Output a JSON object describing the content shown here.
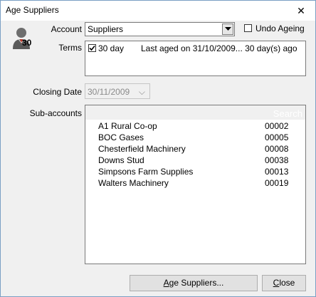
{
  "window": {
    "title": "Age Suppliers",
    "close_glyph": "✕"
  },
  "avatar": {
    "icon": "user-avatar-icon",
    "number": "30"
  },
  "account": {
    "label": "Account",
    "value": "Suppliers"
  },
  "undo_ageing": {
    "label": "Undo Ageing",
    "checked": false
  },
  "terms": {
    "label": "Terms",
    "checked": true,
    "period": "30 day",
    "last_aged": "Last aged on 31/10/2009... 30 day(s) ago"
  },
  "closing_date": {
    "label": "Closing Date",
    "value": "30/11/2009",
    "arrow": "⌵"
  },
  "sub_accounts": {
    "label": "Sub-accounts",
    "search_placeholder": "Search",
    "items": [
      {
        "name": "A1 Rural Co-op",
        "code": "00002"
      },
      {
        "name": "BOC Gases",
        "code": "00005"
      },
      {
        "name": "Chesterfield Machinery",
        "code": "00008"
      },
      {
        "name": "Downs Stud",
        "code": "00038"
      },
      {
        "name": "Simpsons Farm Supplies",
        "code": "00013"
      },
      {
        "name": "Walters Machinery",
        "code": "00019"
      }
    ]
  },
  "buttons": {
    "age_accel": "A",
    "age_rest": "ge Suppliers...",
    "close_accel": "C",
    "close_rest": "lose"
  }
}
